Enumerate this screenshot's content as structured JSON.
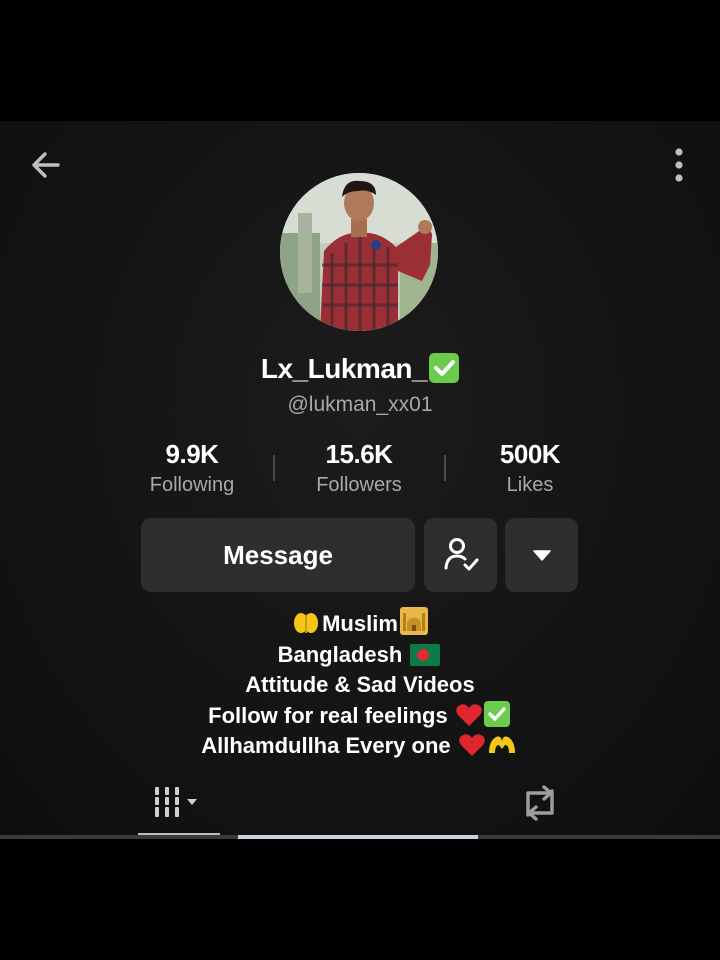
{
  "profile": {
    "display_name": "Lx_Lukman_",
    "handle": "@lukman_xx01",
    "verified_icon": "check-box-icon"
  },
  "stats": {
    "following": {
      "value": "9.9K",
      "label": "Following"
    },
    "followers": {
      "value": "15.6K",
      "label": "Followers"
    },
    "likes": {
      "value": "500K",
      "label": "Likes"
    }
  },
  "actions": {
    "message_label": "Message",
    "follow_icon": "person-check-icon",
    "more_icon": "caret-down-icon"
  },
  "bio": {
    "line1": "Muslim",
    "line2": "Bangladesh",
    "line3": "Attitude & Sad Videos",
    "line4": "Follow for real feelings",
    "line5": "Allhamdullha Every one"
  },
  "tabs": {
    "videos_icon": "grid-bars-icon",
    "reposts_icon": "repost-icon"
  },
  "colors": {
    "background": "#000000",
    "screen": "#141414",
    "button": "#2e2e2e",
    "secondary_text": "#a8a8a8",
    "check_green": "#6bcb4a",
    "heart_red": "#e0262e"
  }
}
